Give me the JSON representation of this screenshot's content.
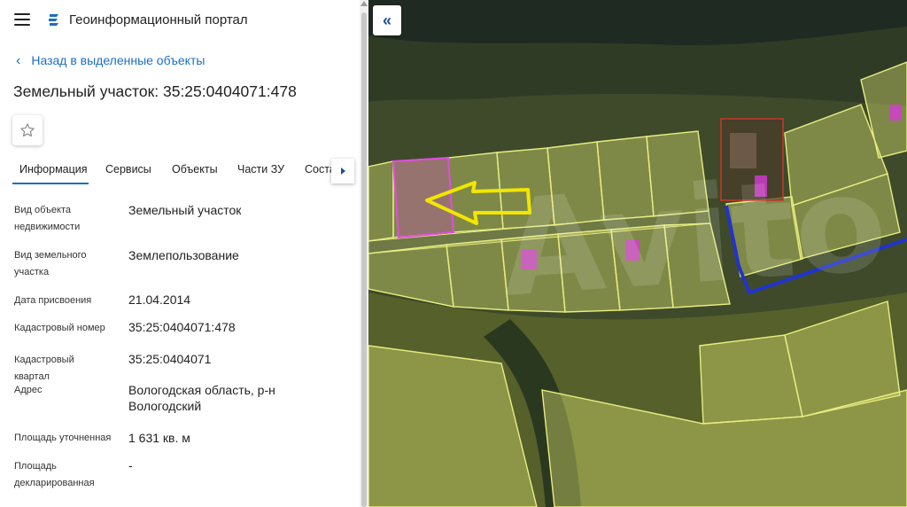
{
  "header": {
    "app_title": "Геоинформационный портал",
    "menu_icon": "hamburger-menu-icon",
    "logo_icon": "portal-logo-icon"
  },
  "back_link": {
    "label": "Назад в выделенные объекты",
    "icon": "chevron-left-icon"
  },
  "page_title": "Земельный участок: 35:25:0404071:478",
  "favorite_icon": "star-outline-icon",
  "tabs": [
    {
      "label": "Информация",
      "active": true
    },
    {
      "label": "Сервисы"
    },
    {
      "label": "Объекты"
    },
    {
      "label": "Части ЗУ"
    },
    {
      "label": "Соста"
    }
  ],
  "properties": [
    {
      "label": "Вид объекта недвижимости",
      "value": "Земельный участок"
    },
    {
      "label": "Вид земельного участка",
      "value": "Землепользование"
    },
    {
      "label": "Дата присвоения",
      "value": "21.04.2014"
    },
    {
      "label": "Кадастровый номер",
      "value": "35:25:0404071:478"
    },
    {
      "label": "Кадастровый квартал",
      "value": "35:25:0404071"
    },
    {
      "label": "Адрес",
      "value": "Вологодская область, р-н Вологодский"
    },
    {
      "label": "Площадь уточненная",
      "value": "1 631 кв. м"
    },
    {
      "label": "Площадь декларированная",
      "value": "-"
    }
  ],
  "map": {
    "collapse_label": "«",
    "watermark": "Avito",
    "colors": {
      "parcel_fill": "#d8e070",
      "parcel_stroke": "#e8ee80",
      "selected": "#d63bd6",
      "arrow": "#f2e600",
      "boundary_blue": "#2233cc",
      "boundary_red": "#c0392b"
    }
  },
  "colors": {
    "accent": "#1a6fc4"
  }
}
